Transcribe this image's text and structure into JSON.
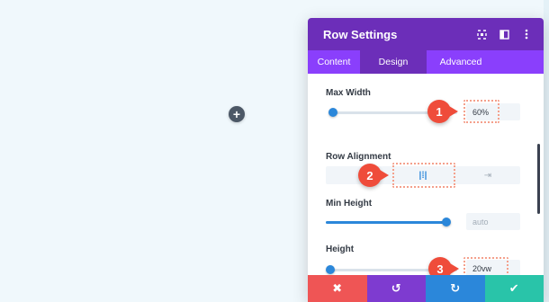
{
  "canvas": {
    "add_icon": "+"
  },
  "modal": {
    "title": "Row Settings",
    "header_icons": [
      "fullscreen-icon",
      "split-view-icon",
      "more-options-icon"
    ],
    "tabs": [
      {
        "label": "Content",
        "active": false
      },
      {
        "label": "Design",
        "active": true
      },
      {
        "label": "Advanced",
        "active": false
      }
    ],
    "fields": {
      "max_width": {
        "label": "Max Width",
        "value": "60%",
        "slider_fraction": 0.02
      },
      "row_alignment": {
        "label": "Row Alignment",
        "options": [
          "",
          "|⁞|",
          "⇥"
        ],
        "selected": 1
      },
      "min_height": {
        "label": "Min Height",
        "value": "auto",
        "slider_fraction": 1.0
      },
      "height": {
        "label": "Height",
        "value": "20vw",
        "slider_fraction": 0.0
      }
    },
    "markers": [
      "1",
      "2",
      "3"
    ],
    "footer": {
      "cancel": "✖",
      "undo": "↺",
      "redo": "↻",
      "save": "✔"
    },
    "colors": {
      "header": "#6c2eb9",
      "tabs": "#8a3ffc",
      "accent": "#2b87da",
      "cancel": "#ef5555",
      "undo": "#7e3bd0",
      "redo": "#2b87da",
      "save": "#29c4a9",
      "marker": "#ef4c3a"
    }
  }
}
